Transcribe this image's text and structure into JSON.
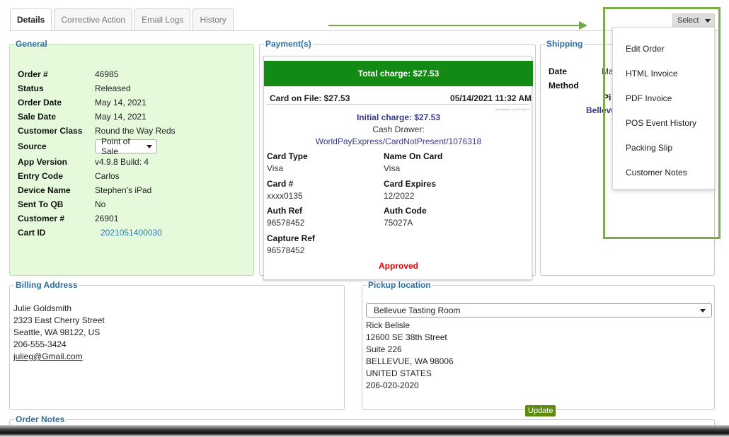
{
  "tabs": [
    "Details",
    "Corrective Action",
    "Email Logs",
    "History"
  ],
  "general": {
    "legend": "General",
    "order_label": "Order #",
    "order_value": "46985",
    "status_label": "Status",
    "status_value": "Released",
    "order_date_label": "Order Date",
    "order_date_value": "May 14, 2021",
    "sale_date_label": "Sale Date",
    "sale_date_value": "May 14, 2021",
    "customer_class_label": "Customer Class",
    "customer_class_value": "Round the Way Reds",
    "source_label": "Source",
    "source_value": "Point of Sale",
    "app_version_label": "App Version",
    "app_version_value": "v4.9.8 Build: 4",
    "entry_code_label": "Entry Code",
    "entry_code_value": "Carlos",
    "device_name_label": "Device Name",
    "device_name_value": "Stephen's iPad",
    "sent_to_qb_label": "Sent To QB",
    "sent_to_qb_value": "No",
    "customer_num_label": "Customer #",
    "customer_num_value": "26901",
    "cart_id_label": "Cart ID",
    "cart_id_value": "2021051400030"
  },
  "payment": {
    "legend": "Payment(s)",
    "total": "Total charge: $27.53",
    "card_on_file": "Card on File: $27.53",
    "datetime": "05/14/2021 11:32 AM",
    "tiny_note": "App Version: v4.9.8 Build: 4",
    "initial": "Initial charge: $27.53",
    "drawer": "Cash Drawer:",
    "processor": "WorldPayExpress/CardNotPresent/1076318",
    "card_type_label": "Card Type",
    "card_type_value": "Visa",
    "name_on_card_label": "Name On Card",
    "name_on_card_value": "Visa",
    "card_num_label": "Card #",
    "card_num_value": "xxxx0135",
    "card_expires_label": "Card Expires",
    "card_expires_value": "12/2022",
    "auth_ref_label": "Auth Ref",
    "auth_ref_value": "96578452",
    "auth_code_label": "Auth Code",
    "auth_code_value": "75027A",
    "capture_ref_label": "Capture Ref",
    "capture_ref_value": "96578452",
    "status": "Approved"
  },
  "shipping": {
    "legend": "Shipping",
    "date_label": "Date",
    "date_partial": "Ma",
    "method_label": "Method",
    "pickup_partial": "Pi",
    "bellevue_partial": "Bellevu"
  },
  "billing": {
    "legend": "Billing Address",
    "name": "Julie Goldsmith",
    "street": "2323 East Cherry Street",
    "city": "Seattle, WA 98122, US",
    "phone": "206-555-3424",
    "email": "julieg@Gmail.com"
  },
  "pickup": {
    "legend": "Pickup location",
    "selected": "Bellevue Tasting Room",
    "contact": "Rick Belisle",
    "street": "12600 SE 38th Street",
    "suite": "Suite 226",
    "city": "BELLEVUE, WA 98006",
    "country": "UNITED STATES",
    "phone": "206-020-2020",
    "update_label": "Update"
  },
  "notes": {
    "legend": "Order Notes"
  },
  "select_menu": {
    "label": "Select",
    "items": [
      "Edit Order",
      "HTML Invoice",
      "PDF Invoice",
      "POS Event History",
      "Packing Slip",
      "Customer Notes"
    ]
  },
  "colors": {
    "accent": "#2a6ea4",
    "total_bar": "#138a13",
    "approved": "#e00000",
    "highlight": "#7aae4b"
  }
}
